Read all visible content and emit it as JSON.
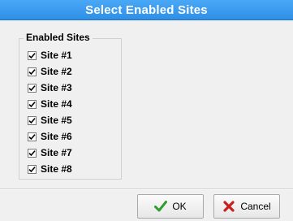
{
  "window": {
    "title": "Select Enabled Sites"
  },
  "group": {
    "title": "Enabled Sites",
    "items": [
      {
        "label": "Site #1",
        "checked": true
      },
      {
        "label": "Site #2",
        "checked": true
      },
      {
        "label": "Site #3",
        "checked": true
      },
      {
        "label": "Site #4",
        "checked": true
      },
      {
        "label": "Site #5",
        "checked": true
      },
      {
        "label": "Site #6",
        "checked": true
      },
      {
        "label": "Site #7",
        "checked": true
      },
      {
        "label": "Site #8",
        "checked": true
      }
    ]
  },
  "buttons": {
    "ok": {
      "label": "OK",
      "icon": "check-icon",
      "icon_color": "#2e9e2e"
    },
    "cancel": {
      "label": "Cancel",
      "icon": "x-icon",
      "icon_color": "#c8201e"
    }
  }
}
